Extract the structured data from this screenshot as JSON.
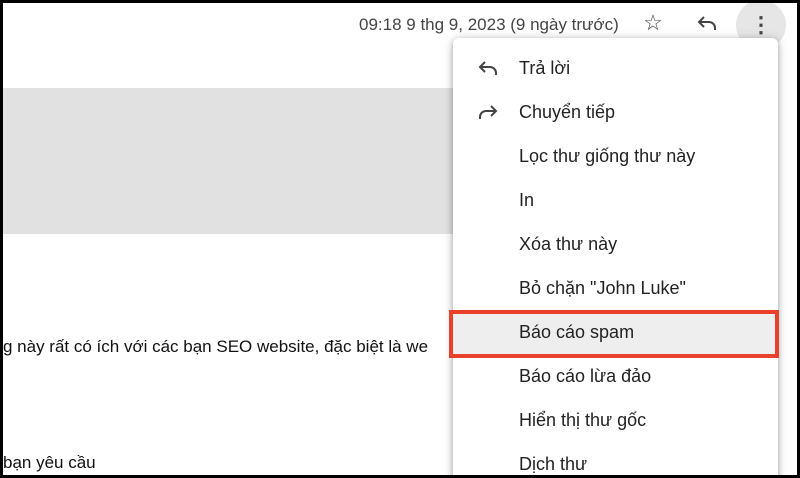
{
  "header": {
    "date": "09:18 9 thg 9, 2023 (9 ngày trước)"
  },
  "body": {
    "line1": "g này rất có ích với các bạn SEO website, đặc biệt là we",
    "line2": "bạn yêu cầu"
  },
  "menu": {
    "items": [
      {
        "label": "Trả lời",
        "icon": "reply-icon"
      },
      {
        "label": "Chuyển tiếp",
        "icon": "forward-icon"
      },
      {
        "label": "Lọc thư giống thư này"
      },
      {
        "label": "In"
      },
      {
        "label": "Xóa thư này"
      },
      {
        "label": "Bỏ chặn \"John Luke\""
      },
      {
        "label": "Báo cáo spam",
        "highlighted": true
      },
      {
        "label": "Báo cáo lừa đảo"
      },
      {
        "label": "Hiển thị thư gốc"
      },
      {
        "label": "Dịch thư"
      }
    ]
  },
  "colors": {
    "highlight": "#e8402a"
  }
}
